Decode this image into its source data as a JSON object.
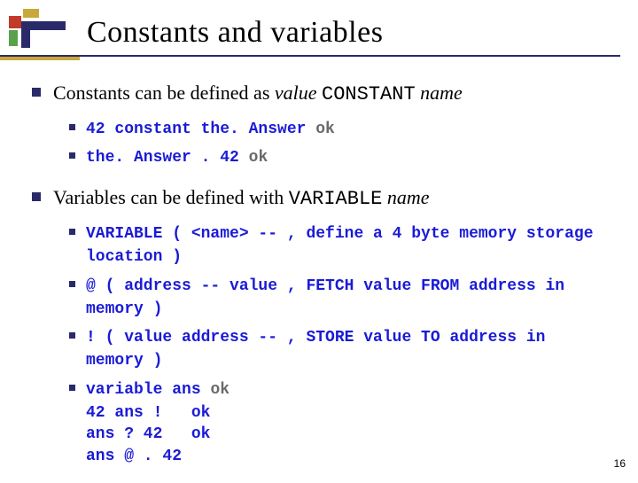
{
  "title": "Constants and variables",
  "bullets": [
    {
      "segments": [
        {
          "t": "Constants can be defined as ",
          "cls": ""
        },
        {
          "t": "value",
          "cls": "italic"
        },
        {
          "t": " ",
          "cls": ""
        },
        {
          "t": "CONSTANT",
          "cls": "mono"
        },
        {
          "t": " ",
          "cls": ""
        },
        {
          "t": "name",
          "cls": "italic"
        }
      ],
      "sub": [
        {
          "code": "42 constant the. Answer ",
          "result": "  ok"
        },
        {
          "code": "the. Answer . 42 ",
          "result": "  ok"
        }
      ]
    },
    {
      "segments": [
        {
          "t": "Variables can be defined with ",
          "cls": ""
        },
        {
          "t": "VARIABLE",
          "cls": "mono"
        },
        {
          "t": " ",
          "cls": ""
        },
        {
          "t": "name",
          "cls": "italic"
        }
      ],
      "sub": [
        {
          "code": "VARIABLE ( <name> -- , define a 4 byte memory storage location )",
          "result": ""
        },
        {
          "code": "@ ( address -- value , FETCH value FROM address in memory )",
          "result": ""
        },
        {
          "code": "! ( value address -- , STORE value TO address in memory )",
          "result": ""
        },
        {
          "code": "variable ans ",
          "result": "  ok",
          "extra": "42 ans !   ok\nans ? 42   ok\nans @ . 42"
        }
      ]
    }
  ],
  "page_number": "16"
}
